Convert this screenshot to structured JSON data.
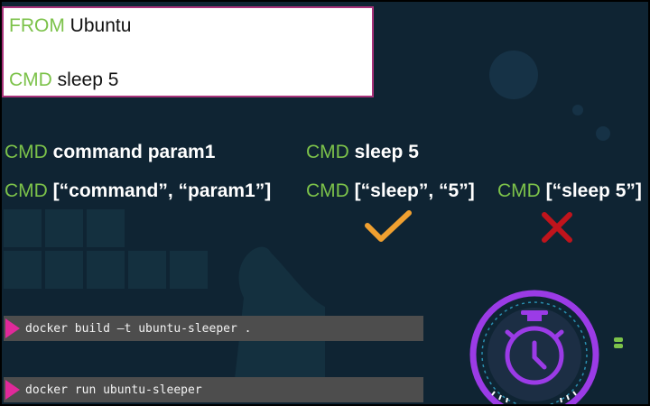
{
  "dockerfile": {
    "line1": {
      "keyword": "FROM",
      "arg": "Ubuntu"
    },
    "line2": {
      "keyword": "CMD",
      "arg": "sleep 5"
    }
  },
  "syntax": {
    "shell_form": {
      "keyword": "CMD",
      "arg": "command param1"
    },
    "exec_form": {
      "keyword": "CMD",
      "arg": "[“command”, “param1”]"
    },
    "shell_example": {
      "keyword": "CMD",
      "arg": "sleep 5"
    },
    "exec_example_valid": {
      "keyword": "CMD",
      "arg": "[“sleep”, “5”]"
    },
    "exec_example_invalid": {
      "keyword": "CMD",
      "arg": "[“sleep 5”]"
    }
  },
  "marks": {
    "valid_icon": "check-icon",
    "valid_color": "#f0a030",
    "invalid_icon": "cross-icon",
    "invalid_color": "#c0141c"
  },
  "terminal": {
    "build_command": "docker build –t ubuntu-sleeper .",
    "run_command": "docker run ubuntu-sleeper"
  },
  "colors": {
    "background": "#0f2433",
    "keyword": "#7cc24a",
    "prompt": "#e0299a",
    "accent": "#9b3be6"
  }
}
